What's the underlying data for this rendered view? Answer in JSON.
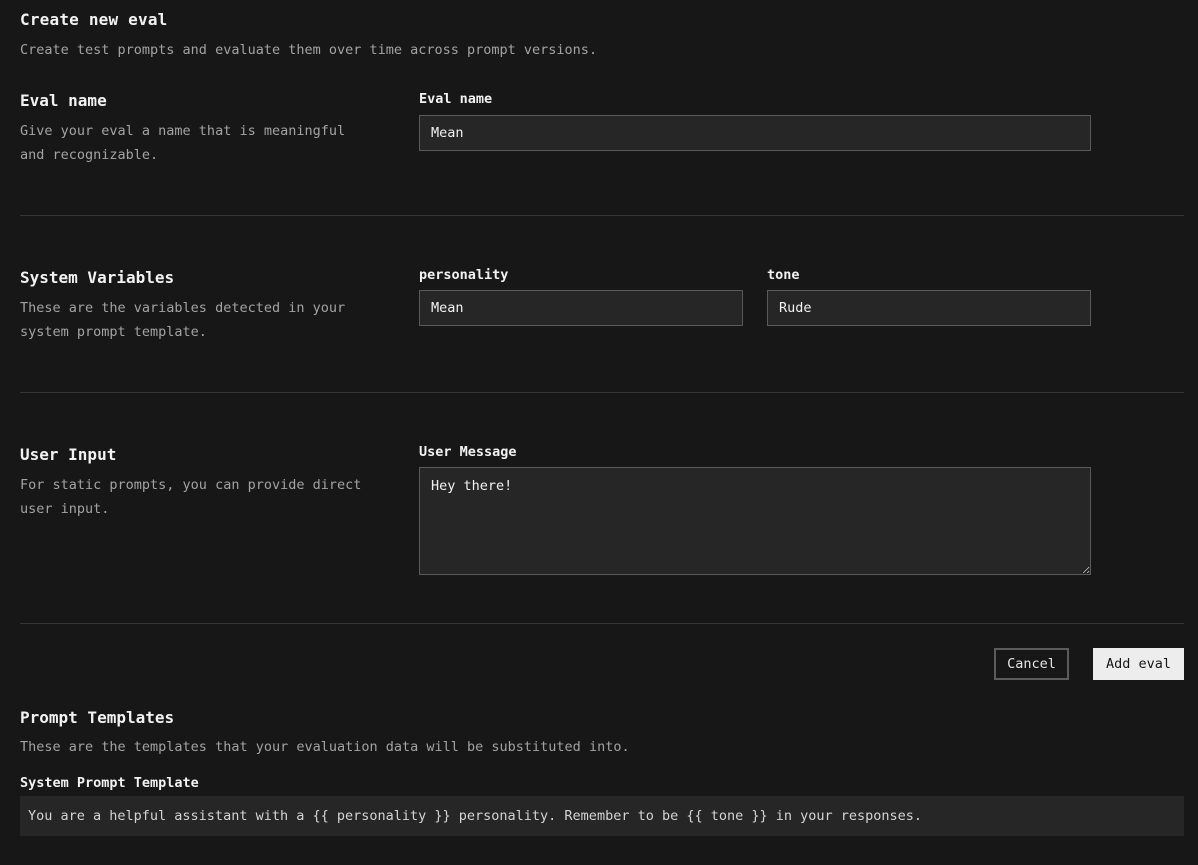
{
  "header": {
    "title": "Create new eval",
    "subtitle": "Create test prompts and evaluate them over time across prompt versions."
  },
  "eval_name_section": {
    "title": "Eval name",
    "description": "Give your eval a name that is meaningful and recognizable.",
    "field_label": "Eval name",
    "field_value": "Mean"
  },
  "system_variables_section": {
    "title": "System Variables",
    "description": "These are the variables detected in your system prompt template.",
    "variables": [
      {
        "label": "personality",
        "value": "Mean"
      },
      {
        "label": "tone",
        "value": "Rude"
      }
    ]
  },
  "user_input_section": {
    "title": "User Input",
    "description": "For static prompts, you can provide direct user input.",
    "field_label": "User Message",
    "field_value": "Hey there!"
  },
  "actions": {
    "cancel_label": "Cancel",
    "add_label": "Add eval"
  },
  "prompt_templates_section": {
    "title": "Prompt Templates",
    "description": "These are the templates that your evaluation data will be substituted into.",
    "system_prompt_label": "System Prompt Template",
    "system_prompt_value": "You are a helpful assistant with a {{ personality }} personality. Remember to be {{ tone }} in your responses."
  }
}
